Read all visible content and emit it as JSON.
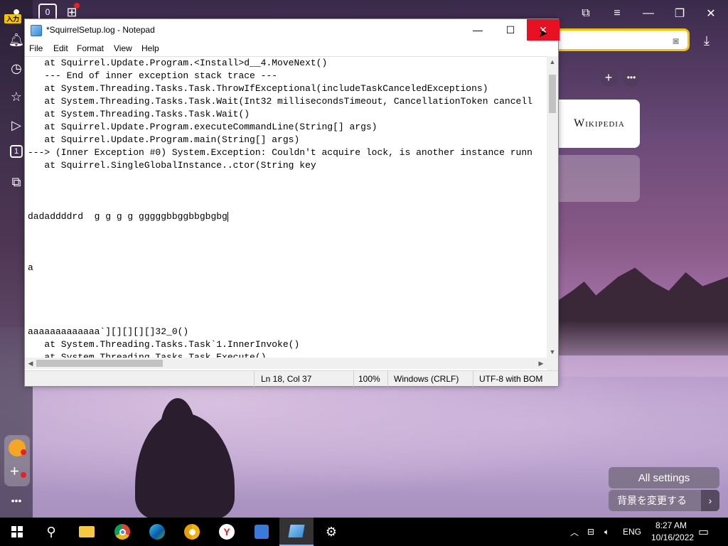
{
  "notepad": {
    "title": "*SquirrelSetup.log - Notepad",
    "menu": [
      "File",
      "Edit",
      "Format",
      "View",
      "Help"
    ],
    "lines": [
      "   at Squirrel.Update.Program.<Install>d__4.MoveNext()",
      "   --- End of inner exception stack trace ---",
      "   at System.Threading.Tasks.Task.ThrowIfExceptional(includeTaskCanceledExceptions)",
      "   at System.Threading.Tasks.Task.Wait(Int32 millisecondsTimeout, CancellationToken cancell",
      "   at System.Threading.Tasks.Task.Wait()",
      "   at Squirrel.Update.Program.executeCommandLine(String[] args)",
      "   at Squirrel.Update.Program.main(String[] args)",
      "---> (Inner Exception #0) System.Exception: Couldn't acquire lock, is another instance runn",
      "   at Squirrel.SingleGlobalInstance..ctor(String key",
      "",
      "",
      "",
      "dadaddddrd  g g g g gggggbbggbbgbgbg",
      "",
      "",
      "",
      "a",
      "",
      "",
      "",
      "",
      "aaaaaaaaaaaaa`][][][][]32_0()",
      "   at System.Threading.Tasks.Task`1.InnerInvoke()",
      "   at System.Threading.Tasks.Task.Execute()"
    ],
    "status": {
      "position": "Ln 18, Col 37",
      "zoom": "100%",
      "line_ending": "Windows (CRLF)",
      "encoding": "UTF-8 with BOM"
    }
  },
  "browser": {
    "sidebar_badge": "入力",
    "tab_count": "0",
    "sidebar_number": "1",
    "wiki_tile": "Wikipedia",
    "all_settings": "All settings",
    "change_background": "背景を変更する"
  },
  "taskbar": {
    "language": "ENG",
    "time": "8:27 AM",
    "date": "10/16/2022"
  }
}
